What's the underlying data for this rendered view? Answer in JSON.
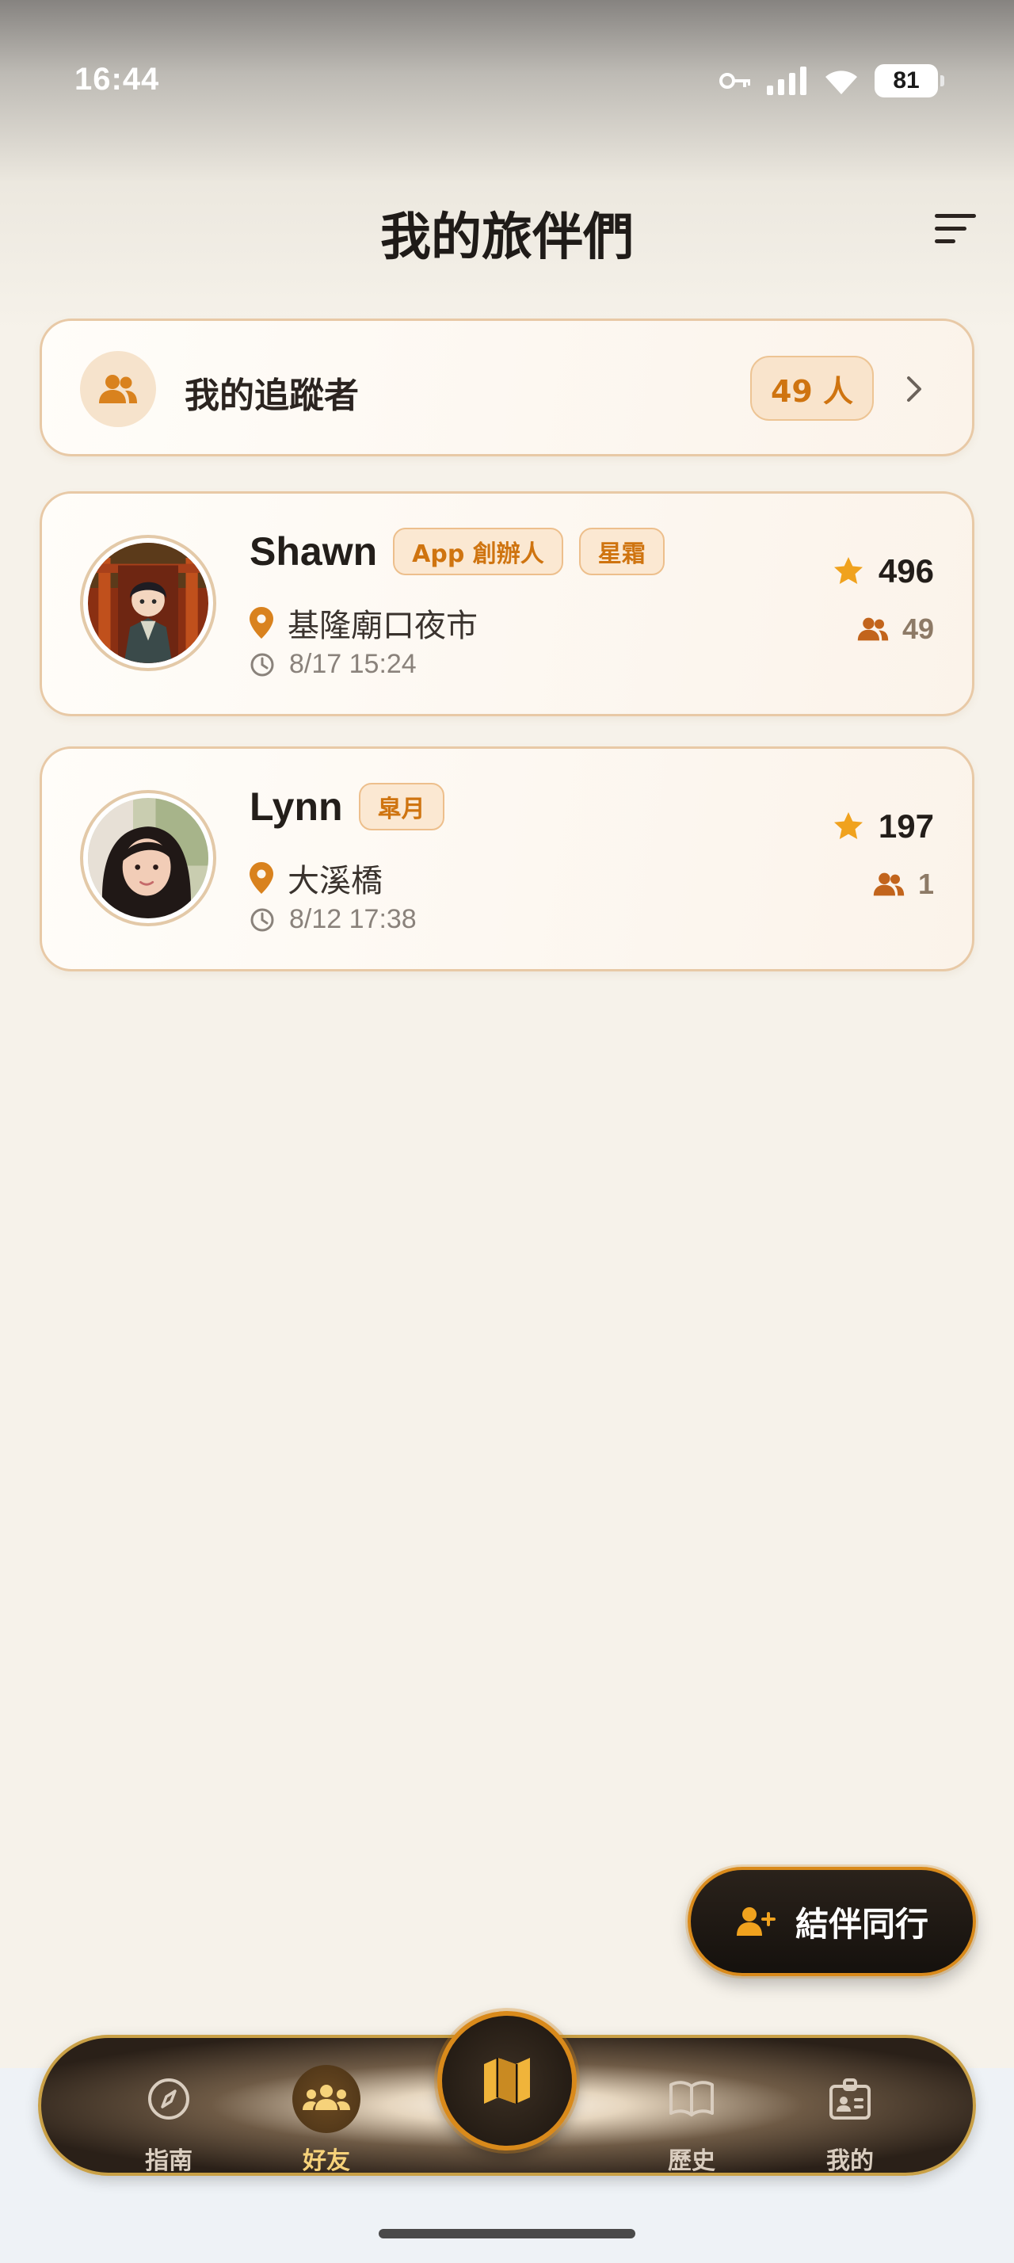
{
  "status_bar": {
    "time": "16:44",
    "battery": "81",
    "icons": [
      "key-icon",
      "signal-icon",
      "wifi-icon",
      "battery-icon"
    ]
  },
  "header": {
    "title": "我的旅伴們",
    "sort_icon": "sort-icon"
  },
  "followers": {
    "label": "我的追蹤者",
    "count": "49 人",
    "icon": "people-icon"
  },
  "friends": [
    {
      "name": "Shawn",
      "tags": [
        "App 創辦人",
        "星霜"
      ],
      "location": "基隆廟口夜市",
      "time": "8/17 15:24",
      "stars": "496",
      "followers": "49"
    },
    {
      "name": "Lynn",
      "tags": [
        "皐月"
      ],
      "location": "大溪橋",
      "time": "8/12 17:38",
      "stars": "197",
      "followers": "1"
    }
  ],
  "fab": {
    "label": "結伴同行",
    "icon": "add-person-icon"
  },
  "tab_bar": {
    "items": [
      {
        "label": "指南",
        "icon": "compass-icon",
        "active": false
      },
      {
        "label": "好友",
        "icon": "group-icon",
        "active": true
      },
      {
        "label": "",
        "icon": "map-icon",
        "active": false
      },
      {
        "label": "歷史",
        "icon": "book-icon",
        "active": false
      },
      {
        "label": "我的",
        "icon": "id-badge-icon",
        "active": false
      }
    ]
  },
  "colors": {
    "accent": "#d98a1b",
    "accent_text": "#cf7410",
    "background": "#f6f2ea",
    "card_border": "#e8c9a6",
    "dark": "#1b140e"
  }
}
